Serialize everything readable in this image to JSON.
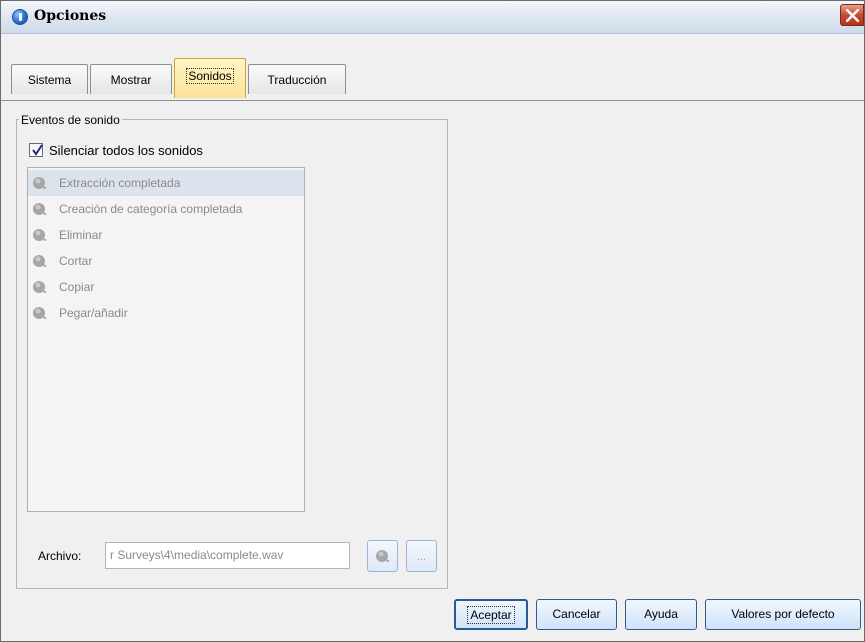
{
  "window": {
    "title": "Opciones",
    "accent": "#2a6fd0",
    "close_color": "#c74b30"
  },
  "tabs": [
    {
      "label": "Sistema",
      "active": false
    },
    {
      "label": "Mostrar",
      "active": false
    },
    {
      "label": "Sonidos",
      "active": true
    },
    {
      "label": "Traducción",
      "active": false
    }
  ],
  "sound_events": {
    "group_title": "Eventos de sonido",
    "mute_all": {
      "label": "Silenciar todos los sonidos",
      "checked": true
    },
    "items": [
      {
        "label": "Extracción completada",
        "icon": "speaker-icon"
      },
      {
        "label": "Creación de categoría completada",
        "icon": "speaker-icon"
      },
      {
        "label": "Eliminar",
        "icon": "speaker-icon"
      },
      {
        "label": "Cortar",
        "icon": "speaker-icon"
      },
      {
        "label": "Copiar",
        "icon": "speaker-icon"
      },
      {
        "label": "Pegar/añadir",
        "icon": "speaker-icon"
      }
    ],
    "file_label": "Archivo:",
    "file_value": "r Surveys\\4\\media\\complete.wav",
    "browse_label": "..."
  },
  "buttons": {
    "ok": "Aceptar",
    "cancel": "Cancelar",
    "help": "Ayuda",
    "defaults": "Valores por defecto"
  }
}
